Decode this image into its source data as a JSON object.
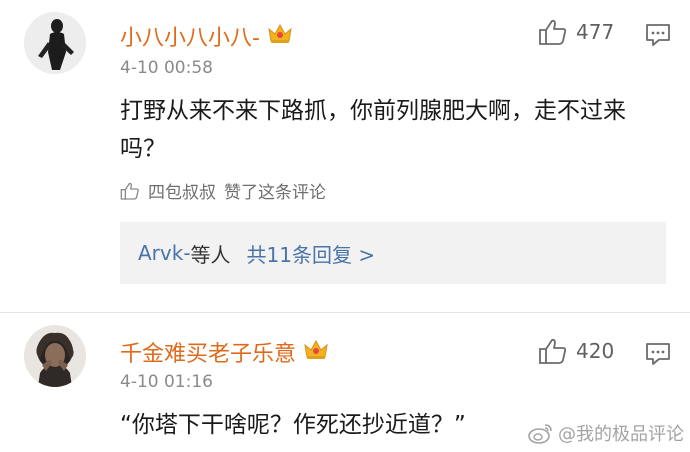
{
  "colors": {
    "username": "#e06a1b",
    "link": "#4a74a9",
    "muted": "#8a8a8a",
    "reply_bg": "#f2f2f2"
  },
  "comments": [
    {
      "username": "小八小八小八-",
      "badge_icon": "crown-vip-icon",
      "time": "4-10 00:58",
      "like_count": "477",
      "text": "打野从来不来下路抓，你前列腺肥大啊，走不过来吗？",
      "liked_by": {
        "name": "四包叔叔",
        "suffix": "赞了这条评论"
      },
      "replies": {
        "names": "Arvk-",
        "suffix": "等人",
        "total": "共11条回复 >"
      }
    },
    {
      "username": "千金难买老子乐意",
      "badge_icon": "crown-vip-icon",
      "time": "4-10 01:16",
      "like_count": "420",
      "text": "“你塔下干啥呢？作死还抄近道？”"
    }
  ],
  "watermark": {
    "text": "@我的极品评论",
    "icon": "weibo-logo"
  }
}
